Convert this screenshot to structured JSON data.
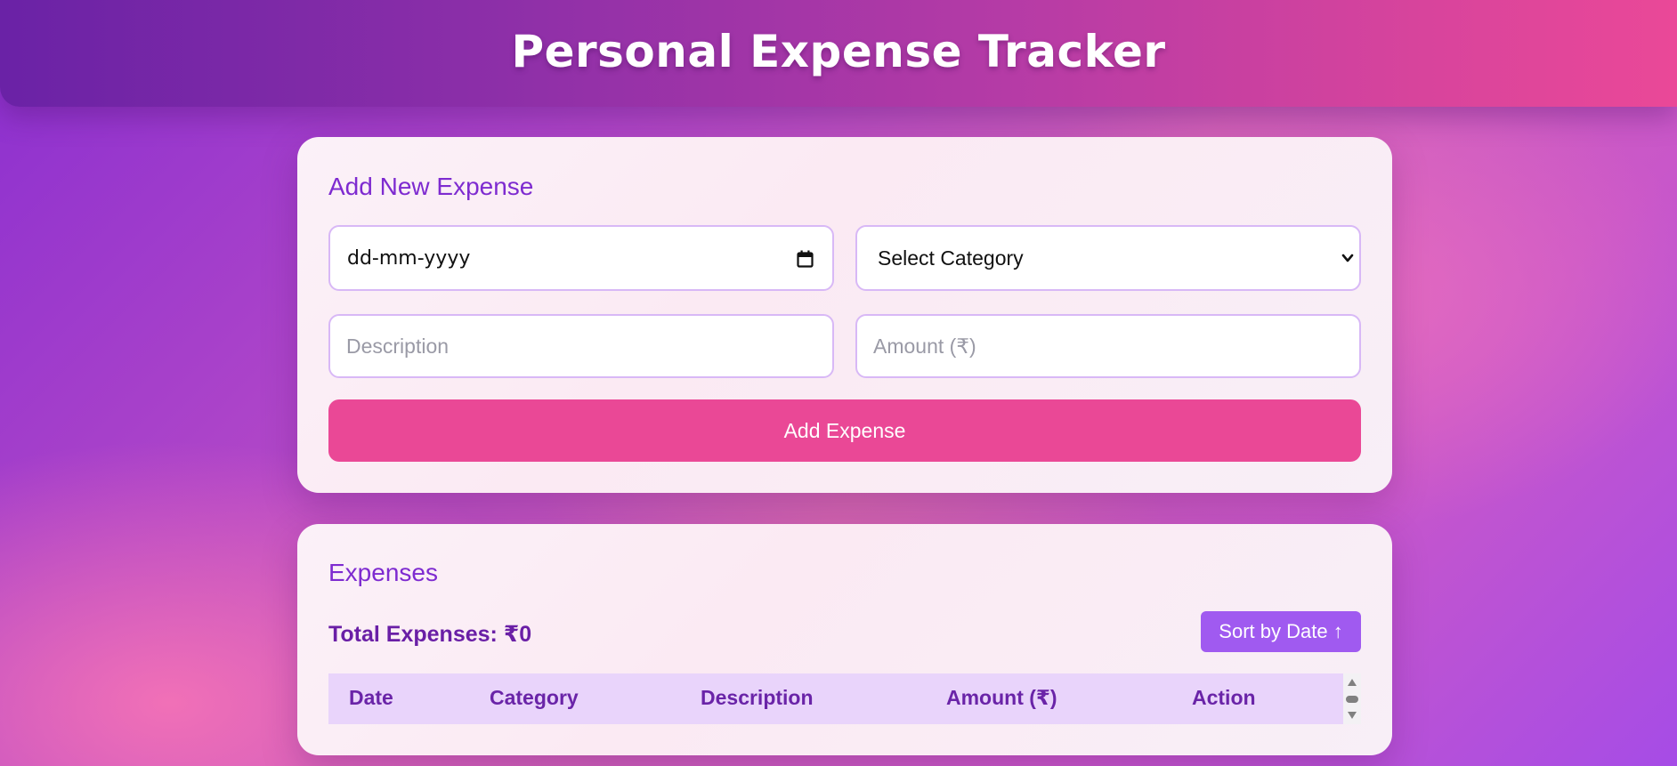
{
  "header": {
    "title": "Personal Expense Tracker"
  },
  "add_form": {
    "title": "Add New Expense",
    "date_field": {
      "placeholder": "dd-mm-yyyy",
      "icon": "calendar-icon"
    },
    "category_select": {
      "selected": "Select Category",
      "icon": "chevron-down-icon"
    },
    "description_input": {
      "value": "",
      "placeholder": "Description"
    },
    "amount_input": {
      "value": "",
      "placeholder": "Amount (₹)"
    },
    "submit_label": "Add Expense"
  },
  "expenses": {
    "title": "Expenses",
    "total_label": "Total Expenses: ₹0",
    "sort_label": "Sort by Date ↑",
    "table": {
      "columns": [
        "Date",
        "Category",
        "Description",
        "Amount (₹)",
        "Action"
      ],
      "rows": []
    }
  },
  "colors": {
    "accent_purple": "#7e2bd0",
    "button_pink": "#ea4896",
    "sort_button": "#a05af0",
    "table_header_bg": "#e9d4fb"
  }
}
